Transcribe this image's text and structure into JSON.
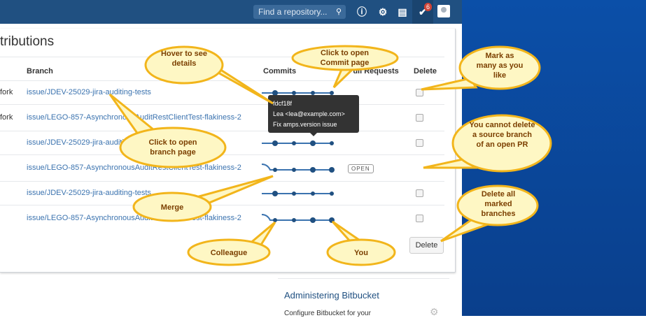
{
  "nav": {
    "search_placeholder": "Find a repository...",
    "notification_count": "6",
    "icons": [
      "search-icon",
      "help-icon",
      "gear-icon",
      "inbox-icon",
      "bitbucket-icon",
      "avatar-icon"
    ]
  },
  "page": {
    "title": "tributions",
    "columns": {
      "branch": "Branch",
      "commits": "Commits",
      "pull_requests": "Pull Requests",
      "delete": "Delete"
    },
    "rows": [
      {
        "fork": "fork",
        "branch": "issue/JDEV-25029-jira-auditing-tests",
        "has_checkbox": true
      },
      {
        "fork": "fork",
        "branch": "issue/LEGO-857-AsynchronousAuditRestClientTest-flakiness-2",
        "has_checkbox": true
      },
      {
        "fork": "",
        "branch": "issue/JDEV-25029-jira-auditing-tests",
        "has_checkbox": true
      },
      {
        "fork": "",
        "branch": "issue/LEGO-857-AsynchronousAuditRestClientTest-flakiness-2",
        "pr_status": "OPEN",
        "has_checkbox": false
      },
      {
        "fork": "",
        "branch": "issue/JDEV-25029-jira-auditing-tests",
        "has_checkbox": true
      },
      {
        "fork": "",
        "branch": "issue/LEGO-857-AsynchronousAuditRestClientTest-flakiness-2",
        "has_checkbox": true
      }
    ],
    "delete_button": "Delete",
    "tooltip": {
      "hash": "fdcf18f",
      "author": "Lea  <lea@example.com>",
      "message": "Fix amps.version issue"
    },
    "side": {
      "heading": "Administering Bitbucket",
      "text": "Configure Bitbucket for your"
    }
  },
  "callouts": {
    "hover": "Hover to see details",
    "commit_page": "Click to open Commit page",
    "mark": "Mark as many as you like",
    "branch_page": "Click to open branch page",
    "cannot_delete": "You cannot delete a source branch of an open PR",
    "merge": "Merge",
    "delete_all": "Delete all marked branches",
    "colleague": "Colleague",
    "you": "You"
  },
  "colors": {
    "nav": "#205081",
    "link": "#3b73af",
    "callout_fill": "#fef7c4",
    "callout_border": "#f2b51b",
    "desktop": "#0a4a9f"
  }
}
